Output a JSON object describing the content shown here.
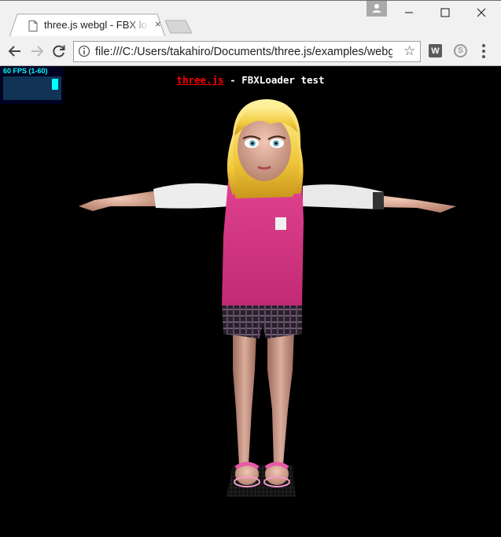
{
  "window": {
    "tab_title": "three.js webgl - FBX loader",
    "tab_close": "×"
  },
  "toolbar": {
    "url": "file:///C:/Users/takahiro/Documents/three.js/examples/webgl_loader_fbx.html",
    "star": "☆",
    "ext_w": "W",
    "ext_s": "S"
  },
  "stats": {
    "fps_label": "60 FPS (1-60)"
  },
  "info": {
    "link_text": "three.js",
    "text": " - FBXLoader test"
  },
  "colors": {
    "fps_text": "#00ffff",
    "fps_bg": "#000022",
    "info_link": "#ff0000",
    "background": "#000000"
  }
}
